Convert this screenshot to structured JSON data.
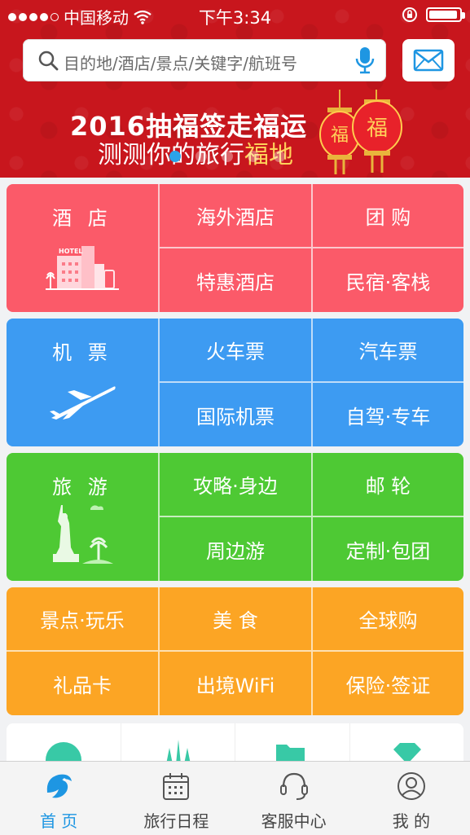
{
  "status_bar": {
    "carrier": "中国移动",
    "time": "下午3:34"
  },
  "search": {
    "placeholder": "目的地/酒店/景点/关键字/航班号"
  },
  "banner": {
    "line1": "2016抽福签走福运",
    "line2_prefix": "测测你的旅行",
    "line2_highlight": "福地",
    "lantern_char": "福"
  },
  "sections": {
    "hotel": {
      "main": "酒 店",
      "items": [
        "海外酒店",
        "团 购",
        "特惠酒店",
        "民宿·客栈"
      ],
      "art_text": "HOTEL"
    },
    "flight": {
      "main": "机 票",
      "items": [
        "火车票",
        "汽车票",
        "国际机票",
        "自驾·专车"
      ]
    },
    "travel": {
      "main": "旅 游",
      "items": [
        "攻略·身边",
        "邮 轮",
        "周边游",
        "定制·包团"
      ]
    },
    "more": {
      "items": [
        "景点·玩乐",
        "美 食",
        "全球购",
        "礼品卡",
        "出境WiFi",
        "保险·签证"
      ]
    }
  },
  "tabbar": {
    "items": [
      "首 页",
      "旅行日程",
      "客服中心",
      "我 的"
    ]
  },
  "colors": {
    "header_red": "#c8161d",
    "hotel": "#fb5a69",
    "flight": "#3d9bf2",
    "travel": "#4ec934",
    "more": "#fca524",
    "active_tab": "#1e96e2"
  }
}
